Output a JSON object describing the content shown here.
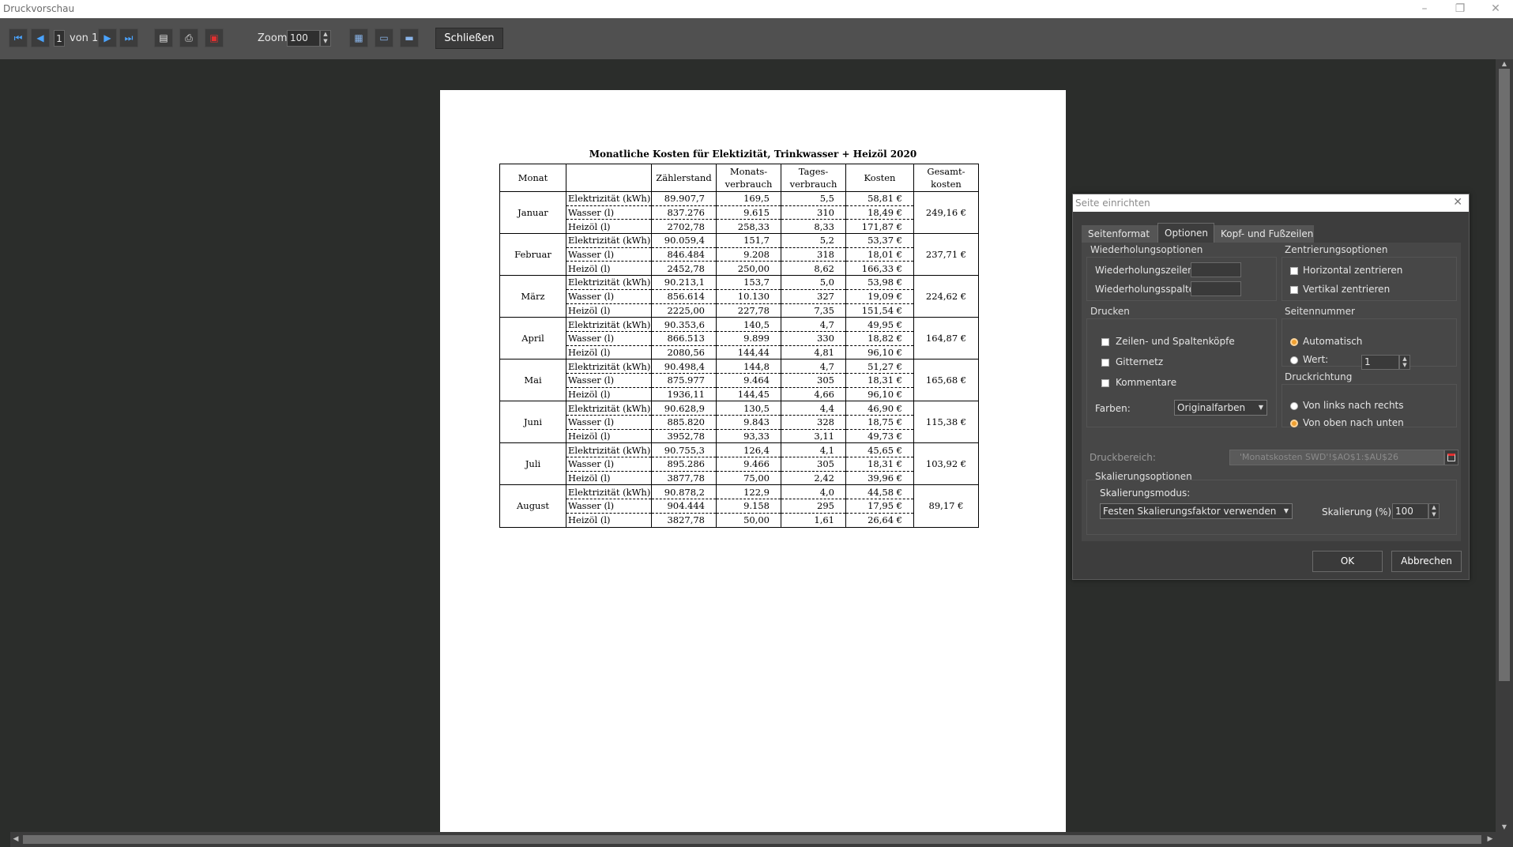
{
  "window": {
    "title": "Druckvorschau"
  },
  "toolbar": {
    "page_current": "1",
    "page_of": "von 1",
    "zoom_label": "Zoom:",
    "zoom_value": "100",
    "close_label": "Schließen"
  },
  "document": {
    "title": "Monatliche Kosten für Elektizität, Trinkwasser + Heizöl 2020",
    "columns": [
      "Monat",
      "",
      "Zählerstand",
      "Monats-\nverbrauch",
      "Tages-\nverbrauch",
      "Kosten",
      "Gesamt-\nkosten"
    ],
    "months": [
      {
        "name": "Januar",
        "total": "249,16 €",
        "rows": [
          [
            "Elektrizität (kWh)",
            "89.907,7",
            "169,5",
            "5,5",
            "58,81 €"
          ],
          [
            "Wasser (l)",
            "837.276",
            "9.615",
            "310",
            "18,49 €"
          ],
          [
            "Heizöl (l)",
            "2702,78",
            "258,33",
            "8,33",
            "171,87 €"
          ]
        ]
      },
      {
        "name": "Februar",
        "total": "237,71 €",
        "rows": [
          [
            "Elektrizität (kWh)",
            "90.059,4",
            "151,7",
            "5,2",
            "53,37 €"
          ],
          [
            "Wasser (l)",
            "846.484",
            "9.208",
            "318",
            "18,01 €"
          ],
          [
            "Heizöl (l)",
            "2452,78",
            "250,00",
            "8,62",
            "166,33 €"
          ]
        ]
      },
      {
        "name": "März",
        "total": "224,62 €",
        "rows": [
          [
            "Elektrizität (kWh)",
            "90.213,1",
            "153,7",
            "5,0",
            "53,98 €"
          ],
          [
            "Wasser (l)",
            "856.614",
            "10.130",
            "327",
            "19,09 €"
          ],
          [
            "Heizöl (l)",
            "2225,00",
            "227,78",
            "7,35",
            "151,54 €"
          ]
        ]
      },
      {
        "name": "April",
        "total": "164,87 €",
        "rows": [
          [
            "Elektrizität (kWh)",
            "90.353,6",
            "140,5",
            "4,7",
            "49,95 €"
          ],
          [
            "Wasser (l)",
            "866.513",
            "9.899",
            "330",
            "18,82 €"
          ],
          [
            "Heizöl (l)",
            "2080,56",
            "144,44",
            "4,81",
            "96,10 €"
          ]
        ]
      },
      {
        "name": "Mai",
        "total": "165,68 €",
        "rows": [
          [
            "Elektrizität (kWh)",
            "90.498,4",
            "144,8",
            "4,7",
            "51,27 €"
          ],
          [
            "Wasser (l)",
            "875.977",
            "9.464",
            "305",
            "18,31 €"
          ],
          [
            "Heizöl (l)",
            "1936,11",
            "144,45",
            "4,66",
            "96,10 €"
          ]
        ]
      },
      {
        "name": "Juni",
        "total": "115,38 €",
        "rows": [
          [
            "Elektrizität (kWh)",
            "90.628,9",
            "130,5",
            "4,4",
            "46,90 €"
          ],
          [
            "Wasser (l)",
            "885.820",
            "9.843",
            "328",
            "18,75 €"
          ],
          [
            "Heizöl (l)",
            "3952,78",
            "93,33",
            "3,11",
            "49,73 €"
          ]
        ]
      },
      {
        "name": "Juli",
        "total": "103,92 €",
        "rows": [
          [
            "Elektrizität (kWh)",
            "90.755,3",
            "126,4",
            "4,1",
            "45,65 €"
          ],
          [
            "Wasser (l)",
            "895.286",
            "9.466",
            "305",
            "18,31 €"
          ],
          [
            "Heizöl (l)",
            "3877,78",
            "75,00",
            "2,42",
            "39,96 €"
          ]
        ]
      },
      {
        "name": "August",
        "total": "89,17 €",
        "rows": [
          [
            "Elektrizität (kWh)",
            "90.878,2",
            "122,9",
            "4,0",
            "44,58 €"
          ],
          [
            "Wasser (l)",
            "904.444",
            "9.158",
            "295",
            "17,95 €"
          ],
          [
            "Heizöl (l)",
            "3827,78",
            "50,00",
            "1,61",
            "26,64 €"
          ]
        ]
      }
    ]
  },
  "dialog": {
    "title": "Seite einrichten",
    "tabs": [
      "Seitenformat",
      "Optionen",
      "Kopf- und Fußzeilen"
    ],
    "active_tab": "Optionen",
    "repeat": {
      "title": "Wiederholungsoptionen",
      "rows_label": "Wiederholungszeilen:",
      "cols_label": "Wiederholungsspalten:",
      "rows_value": "",
      "cols_value": ""
    },
    "center": {
      "title": "Zentrierungsoptionen",
      "horizontal": "Horizontal zentrieren",
      "vertical": "Vertikal zentrieren",
      "horizontal_checked": false,
      "vertical_checked": false
    },
    "print": {
      "title": "Drucken",
      "headers": "Zeilen- und Spaltenköpfe",
      "grid": "Gitternetz",
      "comments": "Kommentare",
      "colors_label": "Farben:",
      "colors_value": "Originalfarben"
    },
    "pagenum": {
      "title": "Seitennummer",
      "auto": "Automatisch",
      "value_label": "Wert:",
      "value": "1",
      "selected": "auto"
    },
    "direction": {
      "title": "Druckrichtung",
      "ltr": "Von links nach rechts",
      "ttb": "Von oben nach unten",
      "selected": "ttb"
    },
    "printrange": {
      "label": "Druckbereich:",
      "value": "'Monatskosten SWD'!$AO$1:$AU$26"
    },
    "scaling": {
      "title": "Skalierungsoptionen",
      "mode_label": "Skalierungsmodus:",
      "mode_value": "Festen Skalierungsfaktor verwenden",
      "factor_label": "Skalierung (%):",
      "factor_value": "100"
    },
    "ok": "OK",
    "cancel": "Abbrechen"
  },
  "colors": {
    "toolbar": "#505050",
    "workspace": "#2b2d2b",
    "dialog": "#3d3d3d",
    "radio_on": "#f0a030",
    "nav_icon": "#4aa3ff"
  }
}
